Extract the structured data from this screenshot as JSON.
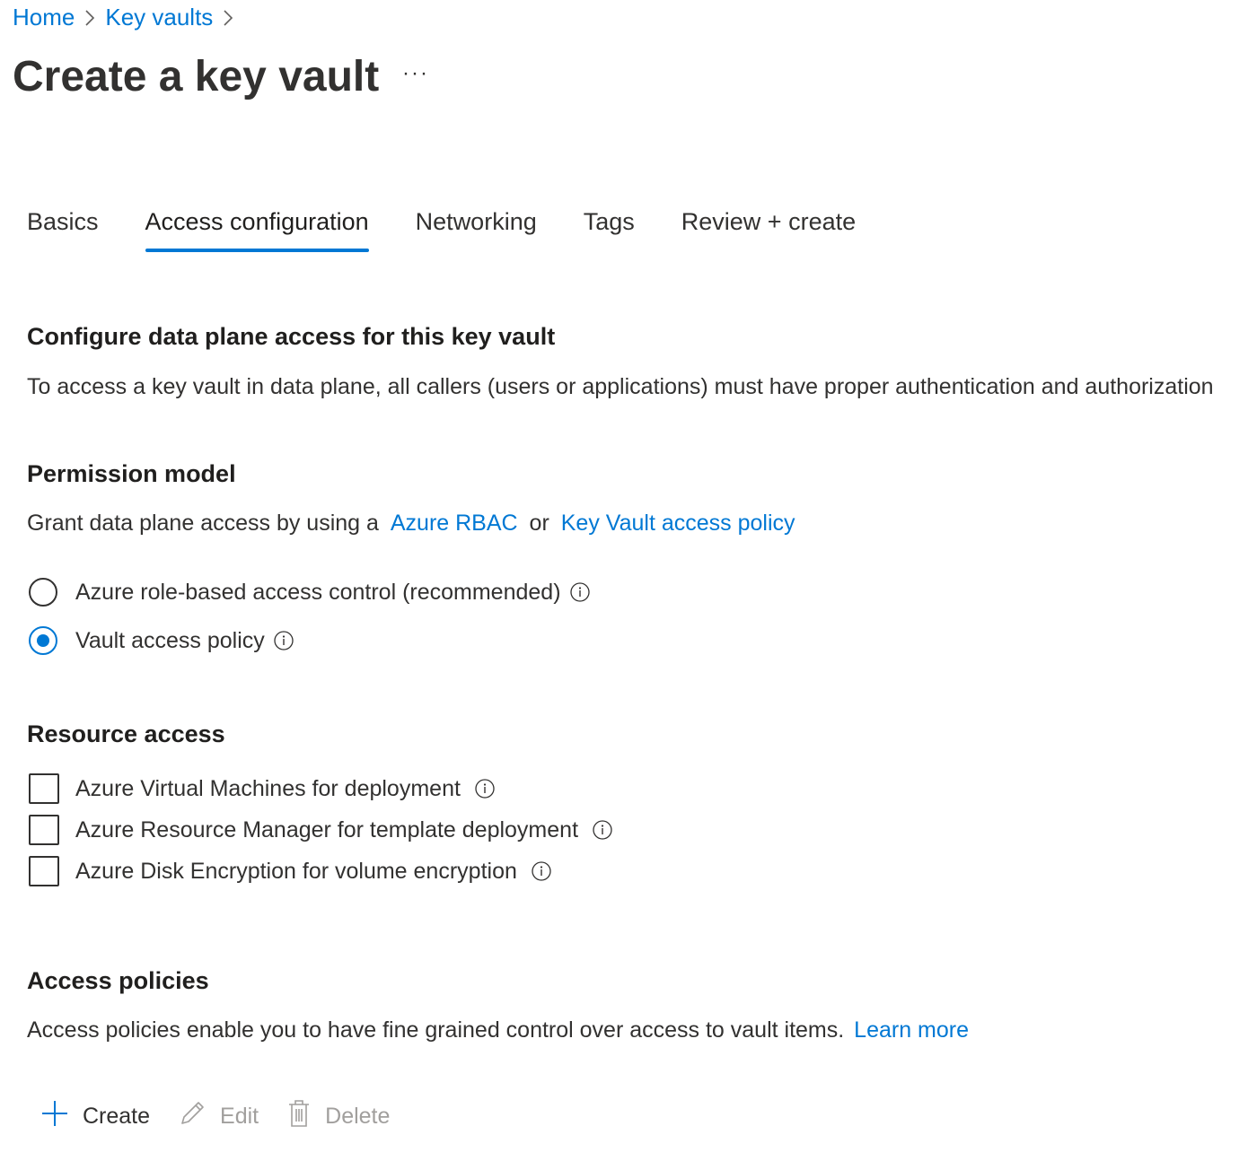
{
  "breadcrumb": {
    "items": [
      "Home",
      "Key vaults"
    ]
  },
  "page": {
    "title": "Create a key vault",
    "more": "···"
  },
  "tabs": [
    {
      "label": "Basics",
      "active": false
    },
    {
      "label": "Access configuration",
      "active": true
    },
    {
      "label": "Networking",
      "active": false
    },
    {
      "label": "Tags",
      "active": false
    },
    {
      "label": "Review + create",
      "active": false
    }
  ],
  "data_plane": {
    "heading": "Configure data plane access for this key vault",
    "description": "To access a key vault in data plane, all callers (users or applications) must have proper authentication and authorization"
  },
  "permission_model": {
    "heading": "Permission model",
    "text_prefix": "Grant data plane access by using a",
    "link_rbac": "Azure RBAC",
    "text_or": "or",
    "link_policy": "Key Vault access policy",
    "options": [
      {
        "label": "Azure role-based access control (recommended)",
        "selected": false
      },
      {
        "label": "Vault access policy",
        "selected": true
      }
    ]
  },
  "resource_access": {
    "heading": "Resource access",
    "options": [
      {
        "label": "Azure Virtual Machines for deployment",
        "checked": false
      },
      {
        "label": "Azure Resource Manager for template deployment",
        "checked": false
      },
      {
        "label": "Azure Disk Encryption for volume encryption",
        "checked": false
      }
    ]
  },
  "access_policies": {
    "heading": "Access policies",
    "description": "Access policies enable you to have fine grained control over access to vault items.",
    "learn_more": "Learn more"
  },
  "toolbar": {
    "create_label": "Create",
    "edit_label": "Edit",
    "delete_label": "Delete"
  },
  "colors": {
    "accent": "#0078d4",
    "text": "#323130",
    "disabled": "#a19f9d"
  }
}
